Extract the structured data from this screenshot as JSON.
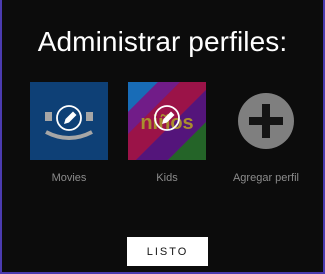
{
  "title": "Administrar perfiles:",
  "profiles": [
    {
      "name": "Movies",
      "avatar_color": "#1663b5",
      "icon": "pencil-edit-icon"
    },
    {
      "name": "Kids",
      "avatar_text": "niños",
      "icon": "pencil-edit-icon"
    }
  ],
  "add_profile": {
    "label": "Agregar perfil",
    "icon": "plus-circle-icon"
  },
  "done_button": {
    "label": "LISTO"
  }
}
